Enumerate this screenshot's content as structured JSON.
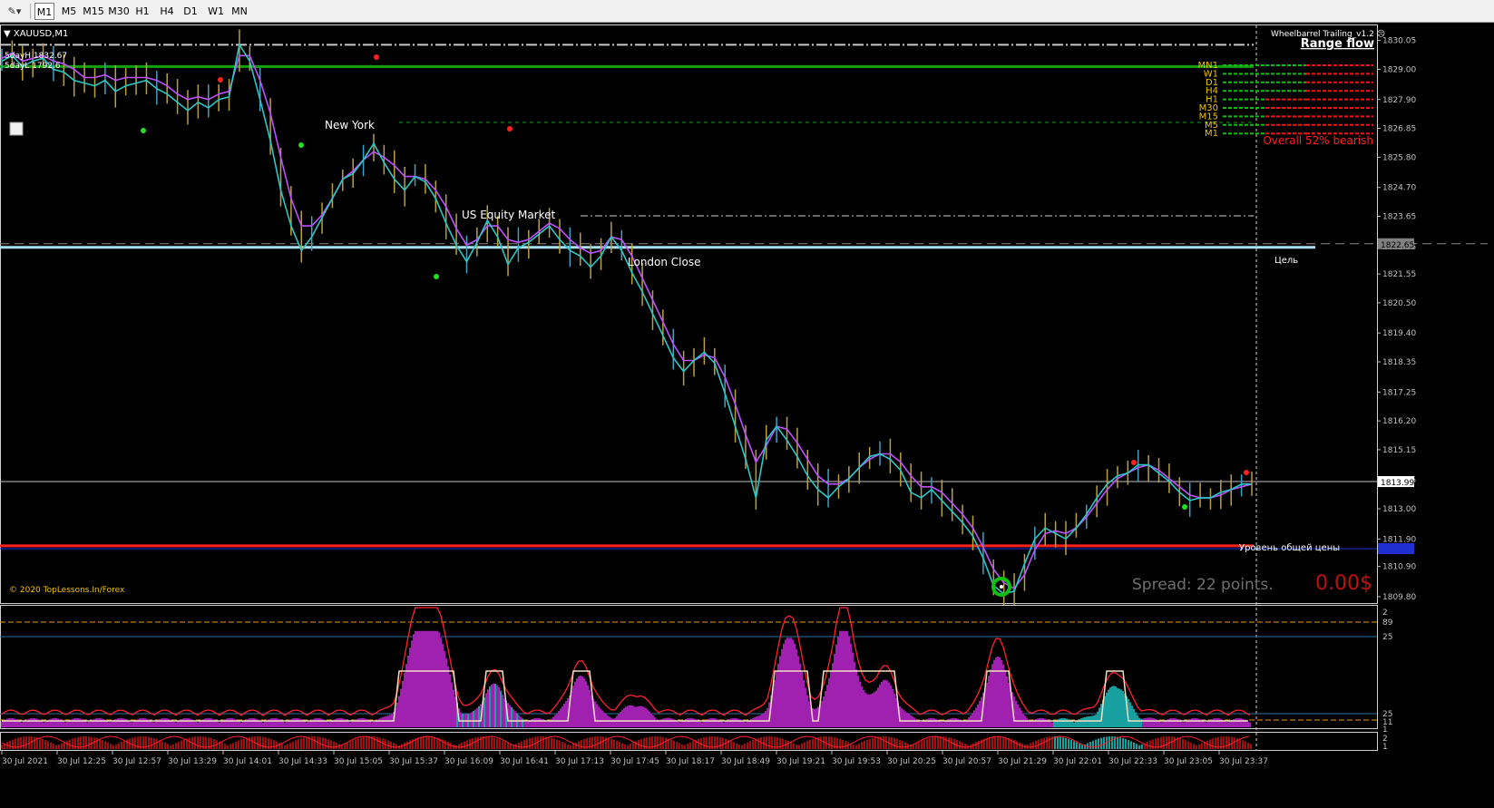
{
  "toolbar": {
    "timeframes": [
      "M1",
      "M5",
      "M15",
      "M30",
      "H1",
      "H4",
      "D1",
      "W1",
      "MN"
    ],
    "active": "M1"
  },
  "chart": {
    "symbol_label": "XAUUSD,M1",
    "info_lines": [
      "5dayH 1832.67",
      "5dayL 1792.6"
    ],
    "copyright": "© 2020 TopLessons.In/Forex",
    "session_labels": [
      "New York",
      "US Equity Market",
      "London Close"
    ],
    "panel_title": "Wheelbarrel Trailing_v1.2",
    "panel_subtitle": "Range flow",
    "tf_labels": [
      "MN1",
      "W1",
      "D1",
      "H4",
      "H1",
      "M30",
      "M15",
      "M5",
      "M1"
    ],
    "overall": "Overall 52% bearish",
    "target_label": "Цель",
    "level_label": "Уровень общей цены",
    "spread_text": "Spread: 22 points.",
    "profit_text": "0.00$",
    "current_price_label": "1813.99",
    "target_price_label": "1822.65",
    "blue_price_label": "1812.43",
    "lower_axis_labels": [
      "2",
      "89",
      "25",
      "25",
      "11",
      "1",
      "2",
      "1"
    ]
  },
  "chart_data": {
    "type": "line",
    "title": "XAUUSD,M1",
    "ylim": [
      1809.6,
      1830.6
    ],
    "y_ticks": [
      1830.05,
      1829.0,
      1827.9,
      1826.85,
      1825.8,
      1824.7,
      1823.65,
      1822.55,
      1821.55,
      1820.5,
      1819.4,
      1818.35,
      1817.25,
      1816.2,
      1815.15,
      1814.05,
      1813.0,
      1811.9,
      1810.9,
      1809.8
    ],
    "x_labels": [
      "30 Jul 2021",
      "30 Jul 12:25",
      "30 Jul 12:57",
      "30 Jul 13:29",
      "30 Jul 14:01",
      "30 Jul 14:33",
      "30 Jul 15:05",
      "30 Jul 15:37",
      "30 Jul 16:09",
      "30 Jul 16:41",
      "30 Jul 17:13",
      "30 Jul 17:45",
      "30 Jul 18:17",
      "30 Jul 18:49",
      "30 Jul 19:21",
      "30 Jul 19:53",
      "30 Jul 20:25",
      "30 Jul 20:57",
      "30 Jul 21:29",
      "30 Jul 22:01",
      "30 Jul 22:33",
      "30 Jul 23:05",
      "30 Jul 23:37"
    ],
    "series": [
      {
        "values": [
          1829.3,
          1829.5,
          1829.1,
          1829.3,
          1829.4,
          1829.0,
          1828.9,
          1828.6,
          1828.5,
          1828.4,
          1828.6,
          1828.2,
          1828.4,
          1828.5,
          1828.6,
          1828.3,
          1828.1,
          1827.8,
          1827.5,
          1827.8,
          1827.6,
          1827.9,
          1828.0,
          1829.9,
          1829.3,
          1827.9,
          1826.4,
          1824.6,
          1823.3,
          1822.4,
          1822.9,
          1823.6,
          1824.3,
          1825.0,
          1825.2,
          1825.7,
          1826.3,
          1825.6,
          1825.0,
          1824.6,
          1825.1,
          1824.9,
          1824.3,
          1823.4,
          1822.6,
          1822.0,
          1822.7,
          1823.5,
          1822.9,
          1821.9,
          1822.5,
          1822.7,
          1823.0,
          1823.3,
          1822.8,
          1822.4,
          1822.2,
          1821.8,
          1822.2,
          1822.9,
          1822.4,
          1821.6,
          1820.9,
          1820.1,
          1819.3,
          1818.5,
          1818.0,
          1818.4,
          1818.7,
          1818.3,
          1817.2,
          1816.0,
          1814.8,
          1813.4,
          1815.5,
          1816.0,
          1815.5,
          1814.9,
          1814.2,
          1813.7,
          1813.4,
          1813.8,
          1814.1,
          1814.5,
          1814.9,
          1815.0,
          1814.8,
          1814.4,
          1813.6,
          1813.4,
          1813.7,
          1813.3,
          1812.9,
          1812.5,
          1812.0,
          1811.2,
          1810.2,
          1809.9,
          1810.0,
          1811.0,
          1811.9,
          1812.3,
          1812.1,
          1811.9,
          1812.3,
          1812.8,
          1813.4,
          1813.9,
          1814.2,
          1814.3,
          1814.6,
          1814.6,
          1814.3,
          1814.0,
          1813.6,
          1813.3,
          1813.4,
          1813.4,
          1813.6,
          1813.7,
          1813.9,
          1813.9
        ]
      },
      {
        "values": [
          1829.4,
          1829.6,
          1829.3,
          1829.4,
          1829.5,
          1829.3,
          1829.2,
          1829.0,
          1828.7,
          1828.7,
          1828.8,
          1828.6,
          1828.7,
          1828.7,
          1828.7,
          1828.6,
          1828.4,
          1828.1,
          1827.9,
          1828.0,
          1827.9,
          1828.1,
          1828.2,
          1829.5,
          1829.5,
          1828.6,
          1827.4,
          1825.8,
          1824.3,
          1823.3,
          1823.3,
          1823.7,
          1824.3,
          1825.0,
          1825.3,
          1825.7,
          1826.0,
          1825.8,
          1825.5,
          1825.1,
          1825.1,
          1825.0,
          1824.6,
          1824.0,
          1823.2,
          1822.6,
          1822.8,
          1823.3,
          1823.3,
          1822.8,
          1822.7,
          1822.8,
          1823.1,
          1823.4,
          1823.2,
          1822.8,
          1822.5,
          1822.3,
          1822.4,
          1822.9,
          1822.8,
          1822.2,
          1821.4,
          1820.6,
          1819.8,
          1819.0,
          1818.4,
          1818.4,
          1818.6,
          1818.5,
          1817.8,
          1816.8,
          1815.7,
          1814.7,
          1815.3,
          1816.0,
          1815.9,
          1815.4,
          1814.8,
          1814.2,
          1813.9,
          1813.9,
          1814.1,
          1814.5,
          1814.8,
          1815.0,
          1815.0,
          1814.7,
          1814.2,
          1813.8,
          1813.8,
          1813.6,
          1813.2,
          1812.8,
          1812.3,
          1811.6,
          1810.8,
          1810.3,
          1810.1,
          1810.6,
          1811.5,
          1812.1,
          1812.2,
          1812.1,
          1812.3,
          1812.7,
          1813.2,
          1813.7,
          1814.1,
          1814.3,
          1814.5,
          1814.6,
          1814.4,
          1814.1,
          1813.8,
          1813.5,
          1813.4,
          1813.4,
          1813.5,
          1813.7,
          1813.8,
          1813.9
        ]
      }
    ],
    "lines": {
      "support_red": 1811.65,
      "target_blue": 1822.65,
      "green_top": 1829.1,
      "current": 1813.99
    },
    "grid": false,
    "legend": "none"
  },
  "colors": {
    "purple_line": "#c050ff",
    "teal_line": "#29c8c8",
    "bars": "#b8a040",
    "red_level": "#ff2020",
    "target": "#a8e0f0",
    "green_level": "#10a010",
    "osc_purple": "#a020b0",
    "osc_teal": "#18a0a0",
    "osc_red": "#ff2030"
  }
}
